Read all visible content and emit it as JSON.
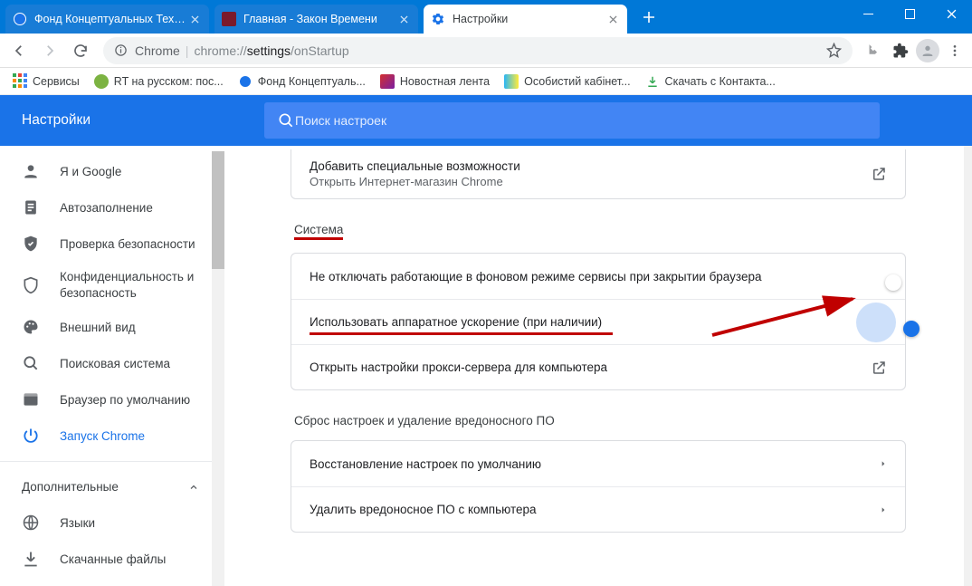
{
  "window": {
    "titlebar_color": "#0078d7",
    "tabs": [
      {
        "title": "Фонд Концептуальных Техноло",
        "active": false
      },
      {
        "title": "Главная - Закон Времени",
        "active": false
      },
      {
        "title": "Настройки",
        "active": true
      }
    ]
  },
  "toolbar": {
    "url_label": "Chrome",
    "url_path_dim1": "chrome://",
    "url_path_bold": "settings",
    "url_path_dim2": "/onStartup"
  },
  "bookmarks": [
    {
      "label": "Сервисы"
    },
    {
      "label": "RT на русском: пос..."
    },
    {
      "label": "Фонд Концептуаль..."
    },
    {
      "label": "Новостная лента"
    },
    {
      "label": "Особистий кабінет..."
    },
    {
      "label": "Скачать с Контакта..."
    }
  ],
  "app": {
    "title": "Настройки",
    "search_placeholder": "Поиск настроек"
  },
  "sidebar": {
    "items": [
      {
        "label": "Я и Google",
        "icon": "person"
      },
      {
        "label": "Автозаполнение",
        "icon": "assignment"
      },
      {
        "label": "Проверка безопасности",
        "icon": "verified"
      },
      {
        "label": "Конфиденциальность и безопасность",
        "icon": "security"
      },
      {
        "label": "Внешний вид",
        "icon": "palette"
      },
      {
        "label": "Поисковая система",
        "icon": "search"
      },
      {
        "label": "Браузер по умолчанию",
        "icon": "browser"
      },
      {
        "label": "Запуск Chrome",
        "icon": "power",
        "active": true
      }
    ],
    "advanced_label": "Дополнительные",
    "advanced_expanded": true,
    "advanced_items": [
      {
        "label": "Языки",
        "icon": "language"
      },
      {
        "label": "Скачанные файлы",
        "icon": "download"
      }
    ]
  },
  "content": {
    "top_card": {
      "line1": "Добавить специальные возможности",
      "line2": "Открыть Интернет-магазин Chrome"
    },
    "system_title": "Система",
    "system_rows": [
      {
        "label": "Не отключать работающие в фоновом режиме сервисы при закрытии браузера",
        "toggle": false
      },
      {
        "label": "Использовать аппаратное ускорение (при наличии)",
        "toggle": true,
        "highlighted": true
      },
      {
        "label": "Открыть настройки прокси-сервера для компьютера",
        "action": "launch"
      }
    ],
    "reset_title": "Сброс настроек и удаление вредоносного ПО",
    "reset_rows": [
      {
        "label": "Восстановление настроек по умолчанию"
      },
      {
        "label": "Удалить вредоносное ПО с компьютера"
      }
    ]
  }
}
